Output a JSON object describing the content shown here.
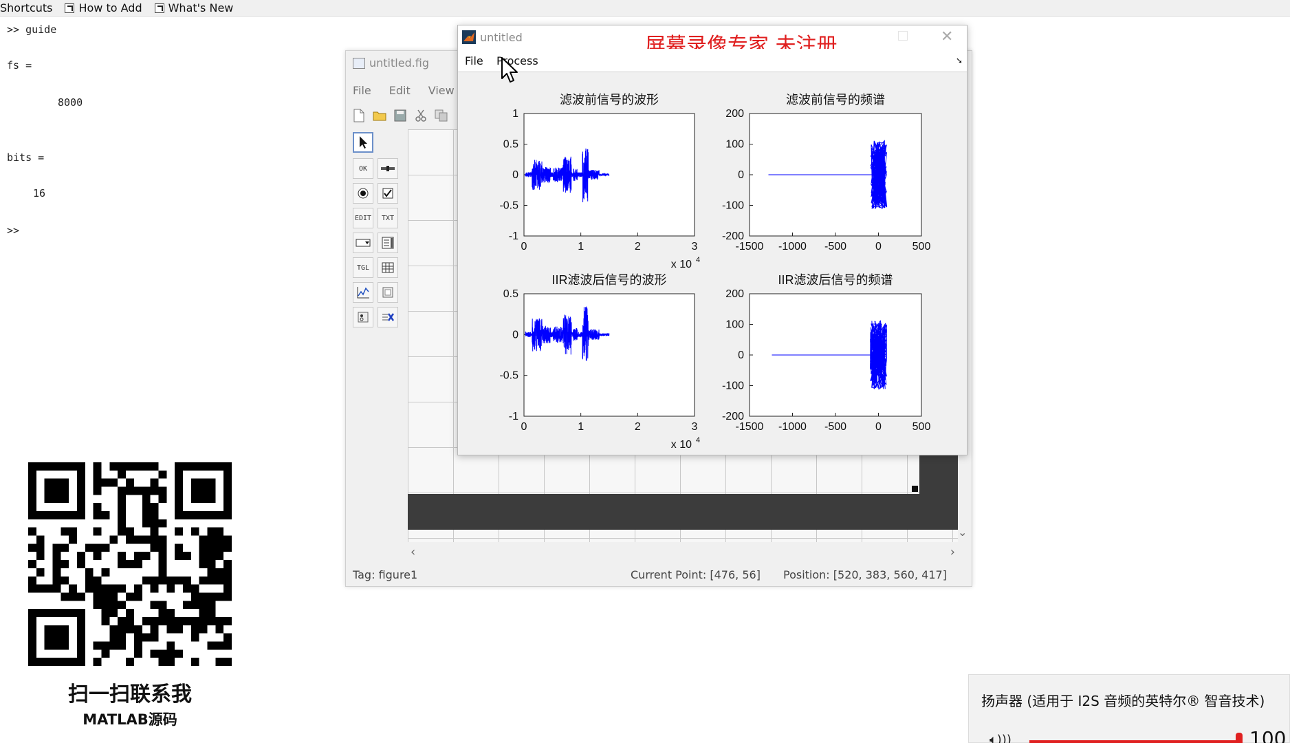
{
  "shortcuts_bar": {
    "label": "Shortcuts",
    "items": [
      "How to Add",
      "What's New"
    ]
  },
  "command_window": {
    "line1": ">> guide",
    "line2": "fs =",
    "line3": "8000",
    "line4": "bits =",
    "line5": "16",
    "prompt": ">>"
  },
  "qr": {
    "caption": "扫一扫联系我",
    "subcaption": "MATLAB源码"
  },
  "guide_window": {
    "title": "untitled.fig",
    "menu": [
      "File",
      "Edit",
      "View"
    ],
    "palette_labels": [
      "OK",
      "EDIT",
      "TXT",
      "TGL"
    ],
    "status_tag": "Tag: figure1",
    "status_current_point": "Current Point:  [476, 56]",
    "status_position": "Position: [520, 383, 560, 417]"
  },
  "figure_window": {
    "title": "untitled",
    "watermark": "屏幕录像专家  未注册",
    "menu": [
      "File",
      "Process"
    ],
    "plots": [
      {
        "title": "滤波前信号的波形",
        "yticks": [
          "1",
          "0.5",
          "0",
          "-0.5",
          "-1"
        ],
        "xticks": [
          "0",
          "1",
          "2",
          "3"
        ],
        "exponent_base": "x 10",
        "exponent_power": "4"
      },
      {
        "title": "滤波前信号的频谱",
        "yticks": [
          "200",
          "100",
          "0",
          "-100",
          "-200"
        ],
        "xticks": [
          "-1500",
          "-1000",
          "-500",
          "0",
          "500"
        ]
      },
      {
        "title": "IIR滤波后信号的波形",
        "yticks": [
          "0.5",
          "0",
          "-0.5",
          "-1"
        ],
        "xticks": [
          "0",
          "1",
          "2",
          "3"
        ],
        "exponent_base": "x 10",
        "exponent_power": "4"
      },
      {
        "title": "IIR滤波后信号的频谱",
        "yticks": [
          "200",
          "100",
          "0",
          "-100",
          "-200"
        ],
        "xticks": [
          "-1500",
          "-1000",
          "-500",
          "0",
          "500"
        ]
      }
    ],
    "trace_color": "#0000ff"
  },
  "sound_panel": {
    "title": "扬声器 (适用于 I2S 音频的英特尔® 智音技术)",
    "volume": "100",
    "accent_color": "#e02020"
  }
}
